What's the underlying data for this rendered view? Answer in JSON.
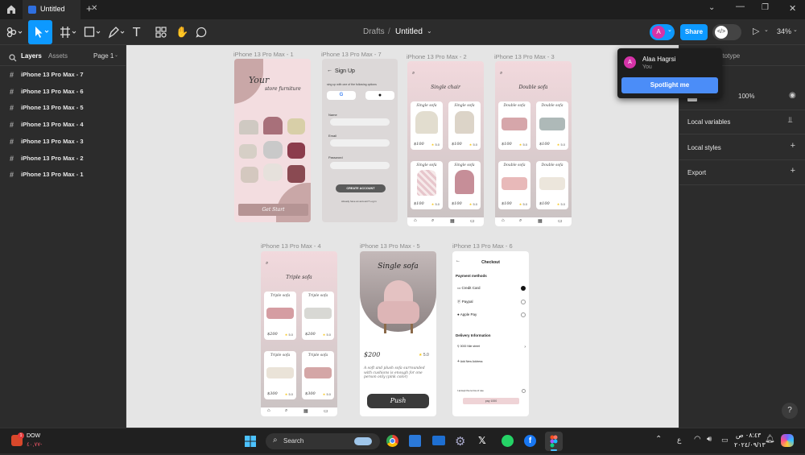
{
  "app": {
    "tab_title": "Untitled",
    "breadcrumb_parent": "Drafts",
    "breadcrumb_sep": "/",
    "file_name": "Untitled",
    "zoom": "34%",
    "share_label": "Share",
    "avatar_letter": "A"
  },
  "left_panel": {
    "tab_layers": "Layers",
    "tab_assets": "Assets",
    "page_select": "Page 1",
    "layers": [
      "iPhone 13 Pro Max - 7",
      "iPhone 13 Pro Max - 6",
      "iPhone 13 Pro Max - 5",
      "iPhone 13 Pro Max - 4",
      "iPhone 13 Pro Max - 3",
      "iPhone 13 Pro Max - 2",
      "iPhone 13 Pro Max - 1"
    ]
  },
  "user_popup": {
    "name": "Alaa Hagrsi",
    "subtitle": "You",
    "spotlight_label": "Spotlight me"
  },
  "right_panel": {
    "tab_partial": "ototype",
    "zoom_value": "100%",
    "local_variables": "Local variables",
    "local_styles": "Local styles",
    "export": "Export",
    "help": "?"
  },
  "frames": {
    "f1": {
      "label": "iPhone 13 Pro Max - 1",
      "heading_line1": "Your",
      "heading_line2": "store furniture",
      "cta": "Get Start"
    },
    "f7": {
      "label": "iPhone 13 Pro Max - 7",
      "title": "Sign Up",
      "subtitle": "sing up with one of the following options",
      "name_label": "Name",
      "email_label": "Email",
      "password_label": "Password",
      "create_btn": "CREATE ACCOUNT",
      "footer": "Already have an account? Log in"
    },
    "f2": {
      "label": "iPhone 13 Pro Max - 2",
      "heading": "Single chair",
      "cards": [
        {
          "title": "Single sofa",
          "price": "$100",
          "rating": "5.0"
        },
        {
          "title": "Single sofa",
          "price": "$100",
          "rating": "5.0"
        },
        {
          "title": "Single sofa",
          "price": "$100",
          "rating": "5.0"
        },
        {
          "title": "Single sofa",
          "price": "$100",
          "rating": "5.0"
        }
      ]
    },
    "f3": {
      "label": "iPhone 13 Pro Max - 3",
      "heading": "Double sofa",
      "cards": [
        {
          "title": "Double sofa",
          "price": "$100",
          "rating": "5.0"
        },
        {
          "title": "Double sofa",
          "price": "$100",
          "rating": "5.0"
        },
        {
          "title": "Double sofa",
          "price": "$100",
          "rating": "5.0"
        },
        {
          "title": "Double sofa",
          "price": "$100",
          "rating": "5.0"
        }
      ]
    },
    "f4": {
      "label": "iPhone 13 Pro Max - 4",
      "heading": "Triple sofa",
      "cards": [
        {
          "title": "Triple sofa",
          "price": "$200",
          "rating": "5.0"
        },
        {
          "title": "Triple sofa",
          "price": "$200",
          "rating": "5.0"
        },
        {
          "title": "Triple sofa",
          "price": "$300",
          "rating": "5.0"
        },
        {
          "title": "Triple sofa",
          "price": "$300",
          "rating": "5.0"
        }
      ]
    },
    "f5": {
      "label": "iPhone 13 Pro Max - 5",
      "heading": "Single sofa",
      "price": "$200",
      "rating": "5.0",
      "desc": "A soft and plush sofa surrounded with cushions is enough for one person only (pink color)",
      "button": "Push"
    },
    "f6": {
      "label": "iPhone 13 Pro Max - 6",
      "title": "Checkout",
      "payment_heading": "Payment methods",
      "methods": [
        "Credit Card",
        "Paypal",
        "Apple Pay"
      ],
      "delivery_heading": "Delivery Information",
      "address": "0000 Nile street",
      "add_address": "Add New Address",
      "agree": "I accept the terms of use",
      "pay_btn": "pay 1000"
    }
  },
  "taskbar": {
    "weather_title": "DOW",
    "weather_value": "٤٠,٧٧-",
    "search": "Search",
    "lang": "ع",
    "time": "٠٨:٤٣ ص",
    "date": "٢٠٢٤/٠٩/١٣"
  },
  "colors": {
    "accent": "#0d99ff",
    "share": "#0d99ff",
    "spotlight": "#4b8df8",
    "avatar": "#d633a8",
    "canvas": "#e5e5e5",
    "pink_frame": "#f3d7dd",
    "frame_grey": "#c9bcbc"
  }
}
